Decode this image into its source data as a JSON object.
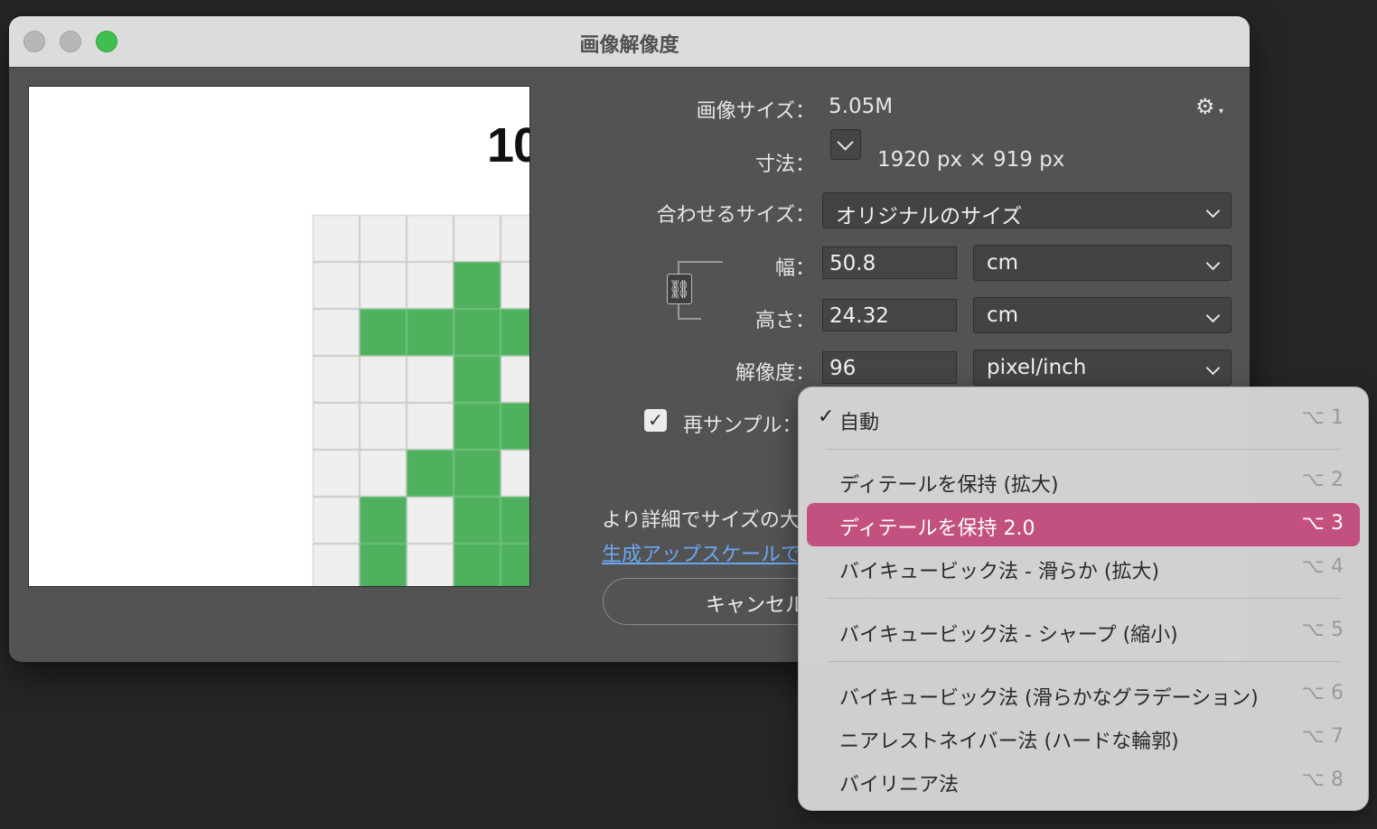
{
  "window": {
    "title": "画像解像度"
  },
  "preview": {
    "text": "10"
  },
  "info": {
    "image_size_label": "画像サイズ：",
    "image_size_value": "5.05M",
    "dimensions_label": "寸法：",
    "dimensions_value": "1920 px × 919 px",
    "fit_label": "合わせるサイズ：",
    "fit_value": "オリジナルのサイズ"
  },
  "width": {
    "label": "幅：",
    "value": "50.8",
    "unit": "cm"
  },
  "height": {
    "label": "高さ：",
    "value": "24.32",
    "unit": "cm"
  },
  "resolution": {
    "label": "解像度：",
    "value": "96",
    "unit": "pixel/inch"
  },
  "resample": {
    "label": "再サンプル：",
    "checked": true
  },
  "description": "より詳細でサイズの大",
  "upscale_link": "生成アップスケールで",
  "cancel_label": "キャンセル",
  "menu": {
    "items": [
      {
        "label": "自動",
        "shortcut": "⌥ 1",
        "checked": true
      },
      {
        "label": "ディテールを保持 (拡大)",
        "shortcut": "⌥ 2"
      },
      {
        "label": "ディテールを保持 2.0",
        "shortcut": "⌥ 3",
        "selected": true
      },
      {
        "label": "バイキュービック法 - 滑らか (拡大)",
        "shortcut": "⌥ 4"
      },
      {
        "label": "バイキュービック法 - シャープ (縮小)",
        "shortcut": "⌥ 5"
      },
      {
        "label": "バイキュービック法 (滑らかなグラデーション)",
        "shortcut": "⌥ 6"
      },
      {
        "label": "ニアレストネイバー法 (ハードな輪郭)",
        "shortcut": "⌥ 7"
      },
      {
        "label": "バイリニア法",
        "shortcut": "⌥ 8"
      }
    ]
  },
  "colors": {
    "highlight": "#c3517f",
    "link": "#6aa8f0",
    "green": "#4fb05d"
  }
}
